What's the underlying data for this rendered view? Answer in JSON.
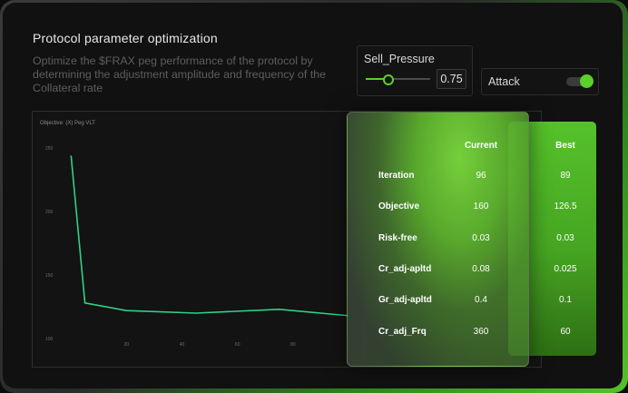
{
  "header": {
    "title": "Protocol parameter optimization",
    "subtitle": "Optimize the $FRAX peg performance of the protocol by determining the adjustment amplitude and frequency of the Collateral rate"
  },
  "controls": {
    "sell_pressure": {
      "label": "Sell_Pressure",
      "value": "0.75",
      "fraction": 0.35
    },
    "attack": {
      "label": "Attack",
      "on": true
    }
  },
  "chart_data": {
    "type": "line",
    "title": "Objective: (X) Peg VLT",
    "x": [
      0,
      5,
      20,
      45,
      75,
      100
    ],
    "y": [
      244,
      128,
      122,
      120,
      123,
      118
    ],
    "xticks": [
      "20",
      "40",
      "60",
      "80"
    ],
    "yticks": [
      "250",
      "200",
      "150",
      "100"
    ],
    "xlim": [
      -5,
      100
    ],
    "ylim": [
      100,
      250
    ],
    "line_color": "#2fd18a",
    "grid": false
  },
  "table": {
    "headers": {
      "current": "Current",
      "best": "Best"
    },
    "rows": [
      {
        "label": "Iteration",
        "current": "96",
        "best": "89"
      },
      {
        "label": "Objective",
        "current": "160",
        "best": "126.5"
      },
      {
        "label": "Risk-free",
        "current": "0.03",
        "best": "0.03"
      },
      {
        "label": "Cr_adj-apltd",
        "current": "0.08",
        "best": "0.025"
      },
      {
        "label": "Gr_adj-apltd",
        "current": "0.4",
        "best": "0.1"
      },
      {
        "label": "Cr_adj_Frq",
        "current": "360",
        "best": "60"
      }
    ]
  },
  "colors": {
    "accent": "#5ccf2b",
    "background": "#101110"
  }
}
